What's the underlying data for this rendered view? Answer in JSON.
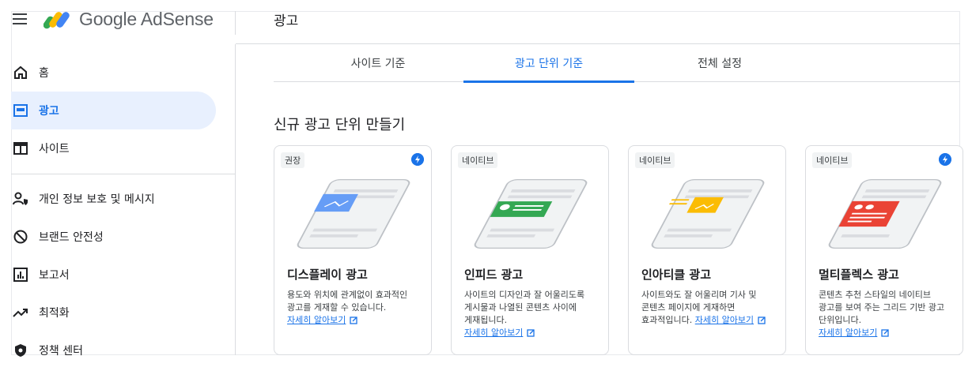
{
  "app": {
    "logo_text": "Google AdSense",
    "page_title": "광고"
  },
  "sidebar": {
    "items": [
      {
        "label": "홈",
        "icon": "home-icon"
      },
      {
        "label": "광고",
        "icon": "ads-icon",
        "active": true
      },
      {
        "label": "사이트",
        "icon": "sites-icon"
      },
      {
        "label": "개인 정보 보호 및 메시지",
        "icon": "privacy-icon"
      },
      {
        "label": "브랜드 안전성",
        "icon": "block-icon"
      },
      {
        "label": "보고서",
        "icon": "reports-icon"
      },
      {
        "label": "최적화",
        "icon": "trending-icon"
      },
      {
        "label": "정책 센터",
        "icon": "policy-icon"
      }
    ]
  },
  "tabs": [
    {
      "label": "사이트 기준"
    },
    {
      "label": "광고 단위 기준",
      "active": true
    },
    {
      "label": "전체 설정"
    }
  ],
  "section_title": "신규 광고 단위 만들기",
  "cards": [
    {
      "badge": "권장",
      "title": "디스플레이 광고",
      "desc": "용도와 위치에 관계없이 효과적인 광고를 게재할 수 있습니다.",
      "learn": "자세히 알아보기",
      "accent": "#669df6",
      "has_bolt": true
    },
    {
      "badge": "네이티브",
      "title": "인피드 광고",
      "desc": "사이트의 디자인과 잘 어울리도록 게시물과 나열된 콘텐츠 사이에 게재됩니다.",
      "learn": "자세히 알아보기",
      "accent": "#34a853",
      "has_bolt": false
    },
    {
      "badge": "네이티브",
      "title": "인아티클 광고",
      "desc": "사이트와도 잘 어울리며 기사 및 콘텐츠 페이지에 게재하면 효과적입니다.",
      "learn": "자세히 알아보기",
      "accent": "#fbbc04",
      "has_bolt": false
    },
    {
      "badge": "네이티브",
      "title": "멀티플렉스 광고",
      "desc": "콘텐츠 추천 스타일의 네이티브 광고를 보여 주는 그리드 기반 광고 단위입니다.",
      "learn": "자세히 알아보기",
      "accent": "#ea4335",
      "has_bolt": true
    }
  ],
  "colors": {
    "brand_blue": "#1a73e8",
    "active_bg": "#e8f0fe"
  }
}
